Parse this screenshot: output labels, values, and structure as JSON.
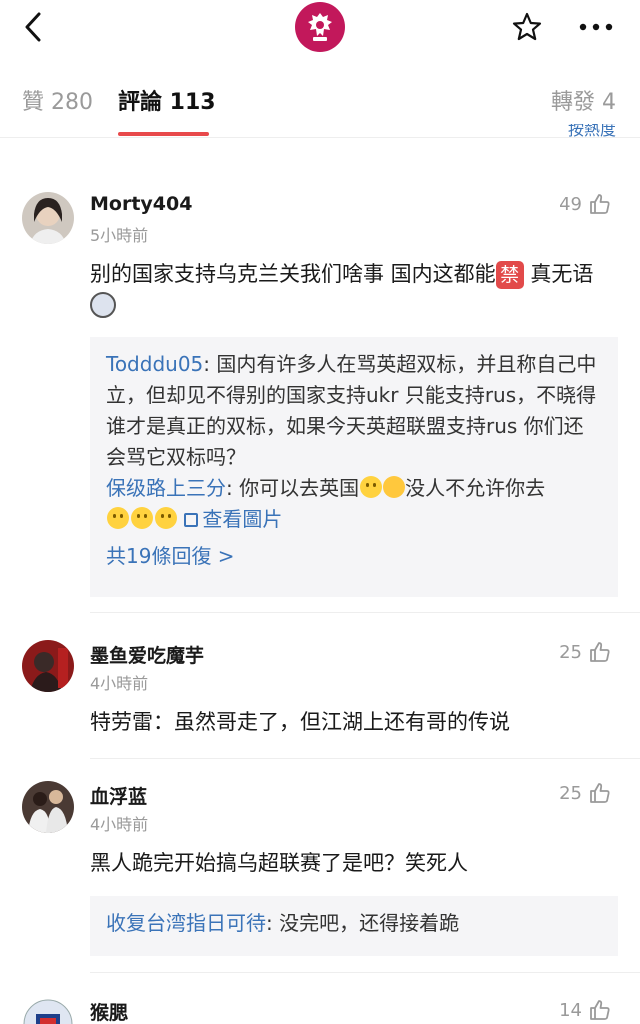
{
  "nav": {
    "back_icon": "chevron-left-icon",
    "logo_icon": "premier-league-lion-icon",
    "favorite_icon": "star-outline-icon",
    "more_icon": "more-dots-icon"
  },
  "tabs": {
    "likes": "贊 280",
    "comments": "評論 113",
    "reposts": "轉發 4",
    "sort_partial": "按熱度"
  },
  "colors": {
    "accent": "#e8494b",
    "link": "#3a73b8",
    "logo_bg": "#c2185b"
  },
  "comments": [
    {
      "user": "Morty404",
      "time": "5小時前",
      "likes": "49",
      "text_a": "别的国家支持乌克兰关我们啥事 国内这都能",
      "ban_char": "禁",
      "text_b": " 真无语",
      "replies": [
        {
          "user": "Todddu05",
          "text": ": 国内有许多人在骂英超双标，并且称自己中立，但却见不得别的国家支持ukr 只能支持rus，不晓得谁才是真正的双标，如果今天英超联盟支持rus 你们还会骂它双标吗？"
        },
        {
          "user": "保级路上三分",
          "text_a": ": 你可以去英国",
          "text_b": "没人不允许你去",
          "view_image": "查看圖片"
        }
      ],
      "more_replies": "共19條回復 >"
    },
    {
      "user": "墨鱼爱吃魔芋",
      "time": "4小時前",
      "likes": "25",
      "text": "特劳雷：虽然哥走了，但江湖上还有哥的传说"
    },
    {
      "user": "血浮蓝",
      "time": "4小時前",
      "likes": "25",
      "text": "黑人跪完开始搞乌超联赛了是吧？笑死人",
      "reply": {
        "user": "收复台湾指日可待",
        "text": ": 没完吧，还得接着跪"
      }
    },
    {
      "user": "猴腮",
      "likes": "14"
    }
  ]
}
